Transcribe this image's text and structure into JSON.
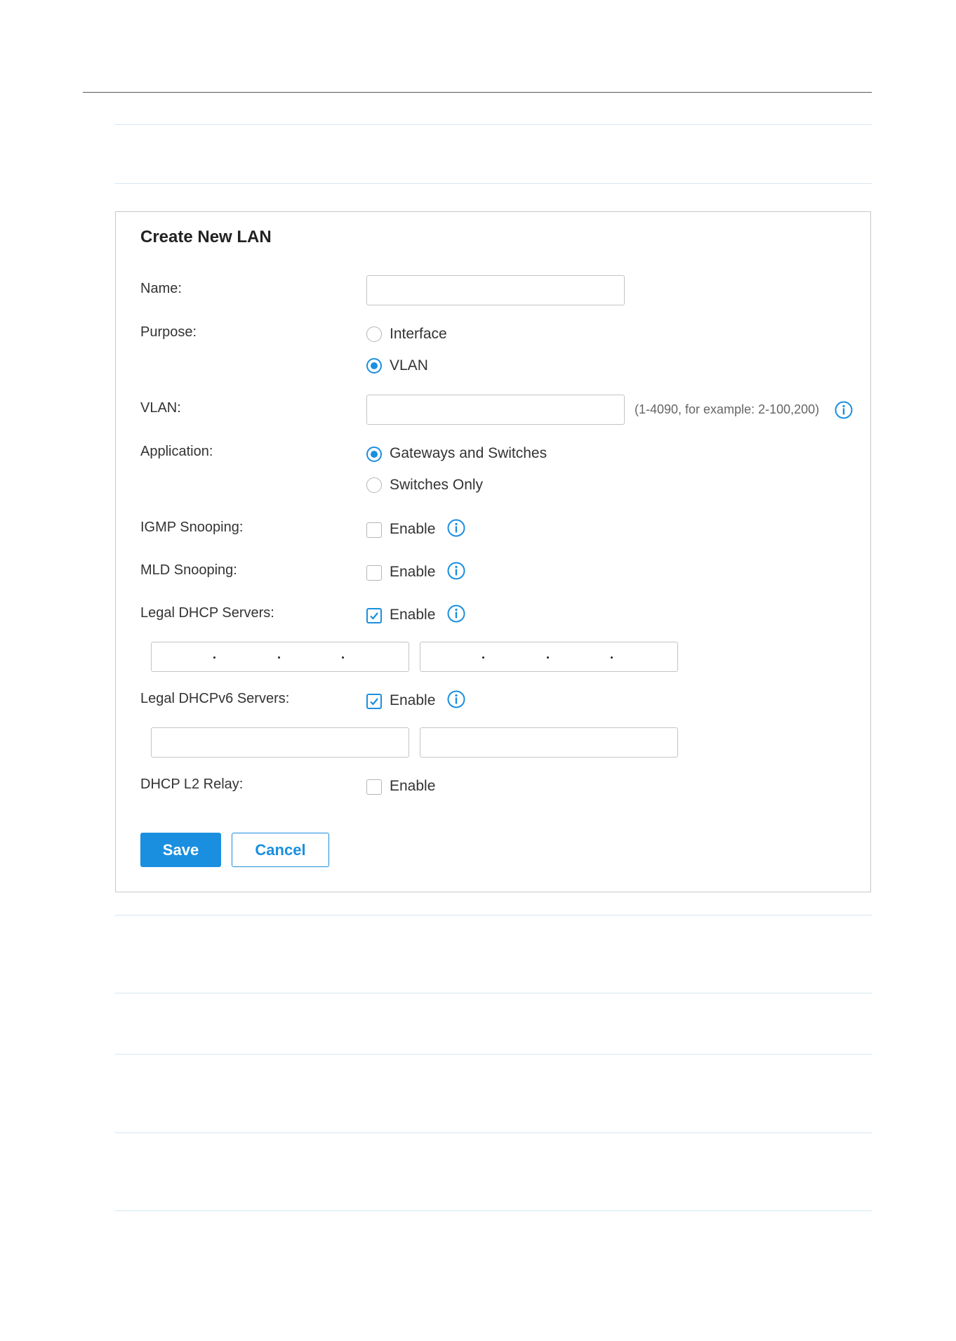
{
  "form": {
    "title": "Create New LAN",
    "name": {
      "label": "Name:",
      "value": ""
    },
    "purpose": {
      "label": "Purpose:",
      "options": [
        {
          "label": "Interface",
          "selected": false
        },
        {
          "label": "VLAN",
          "selected": true
        }
      ]
    },
    "vlan": {
      "label": "VLAN:",
      "value": "",
      "hint": "(1-4090, for example: 2-100,200)"
    },
    "application": {
      "label": "Application:",
      "options": [
        {
          "label": "Gateways and Switches",
          "selected": true
        },
        {
          "label": "Switches Only",
          "selected": false
        }
      ]
    },
    "igmp_snooping": {
      "label": "IGMP Snooping:",
      "option": "Enable",
      "checked": false
    },
    "mld_snooping": {
      "label": "MLD Snooping:",
      "option": "Enable",
      "checked": false
    },
    "legal_dhcp_servers": {
      "label": "Legal DHCP Servers:",
      "option": "Enable",
      "checked": true,
      "ip1": "",
      "ip2": ""
    },
    "legal_dhcpv6_servers": {
      "label": "Legal DHCPv6 Servers:",
      "option": "Enable",
      "checked": true,
      "ip1": "",
      "ip2": ""
    },
    "dhcp_l2_relay": {
      "label": "DHCP L2 Relay:",
      "option": "Enable",
      "checked": false
    },
    "buttons": {
      "save": "Save",
      "cancel": "Cancel"
    }
  },
  "colors": {
    "accent": "#1a8fe0",
    "separator": "#d6e6f2",
    "border": "#c4c4c4"
  },
  "icons": {
    "info": "info-circle-icon",
    "check": "checkmark-icon"
  }
}
